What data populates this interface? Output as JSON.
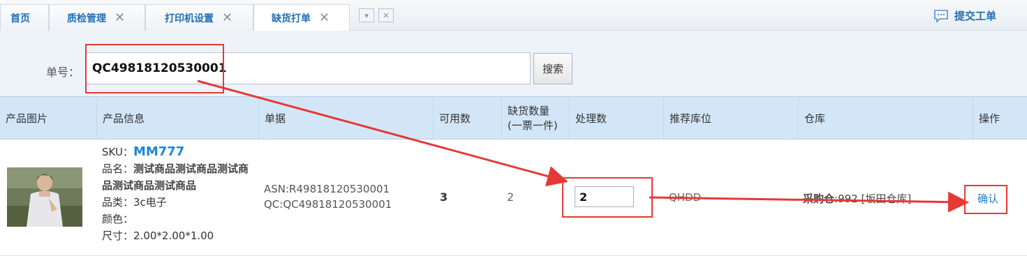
{
  "tabs": [
    {
      "label": "首页",
      "closable": false,
      "active": false
    },
    {
      "label": "质检管理",
      "closable": true,
      "active": false
    },
    {
      "label": "打印机设置",
      "closable": true,
      "active": false
    },
    {
      "label": "缺货打单",
      "closable": true,
      "active": true
    }
  ],
  "tab_close_glyph": "✕",
  "tab_dropdown_glyph": "▾",
  "tab_close_all_glyph": "✕",
  "submit_ticket_label": "提交工单",
  "search": {
    "label": "单号：",
    "value": "QC49818120530001",
    "button_label": "搜索"
  },
  "table": {
    "headers": [
      "产品图片",
      "产品信息",
      "单据",
      "可用数",
      "缺货数量(一票一件)",
      "处理数",
      "推荐库位",
      "仓库",
      "操作"
    ],
    "header_shortage_line1": "缺货数量",
    "header_shortage_line2": "(一票一件)",
    "row": {
      "sku_label": "SKU：",
      "sku_value": "MM777",
      "name_label": "品名：",
      "name_value": "测试商品测试商品测试商品测试商品测试商品",
      "category_label": "品类：",
      "category_value": "3c电子",
      "color_label": "颜色：",
      "color_value": "",
      "size_label": "尺寸：",
      "size_value": "2.00*2.00*1.00",
      "asn": "ASN:R49818120530001",
      "qc": "QC:QC49818120530001",
      "available": "3",
      "shortage": "2",
      "process_qty": "2",
      "location": "QHDD",
      "warehouse_bold": "采购仓",
      "warehouse_rest": ":992 [坂田仓库]",
      "action_label": "确认"
    }
  },
  "colors": {
    "accent": "#1f6fb5",
    "link": "#1f7fd0",
    "annotation": "#e53935",
    "header_bg": "#d3e6f8",
    "search_bg": "#eef3f9"
  },
  "icons": {
    "submit_ticket": "chat-bubble-icon",
    "tab_close": "close-icon",
    "tab_menu": "chevron-down-icon"
  }
}
